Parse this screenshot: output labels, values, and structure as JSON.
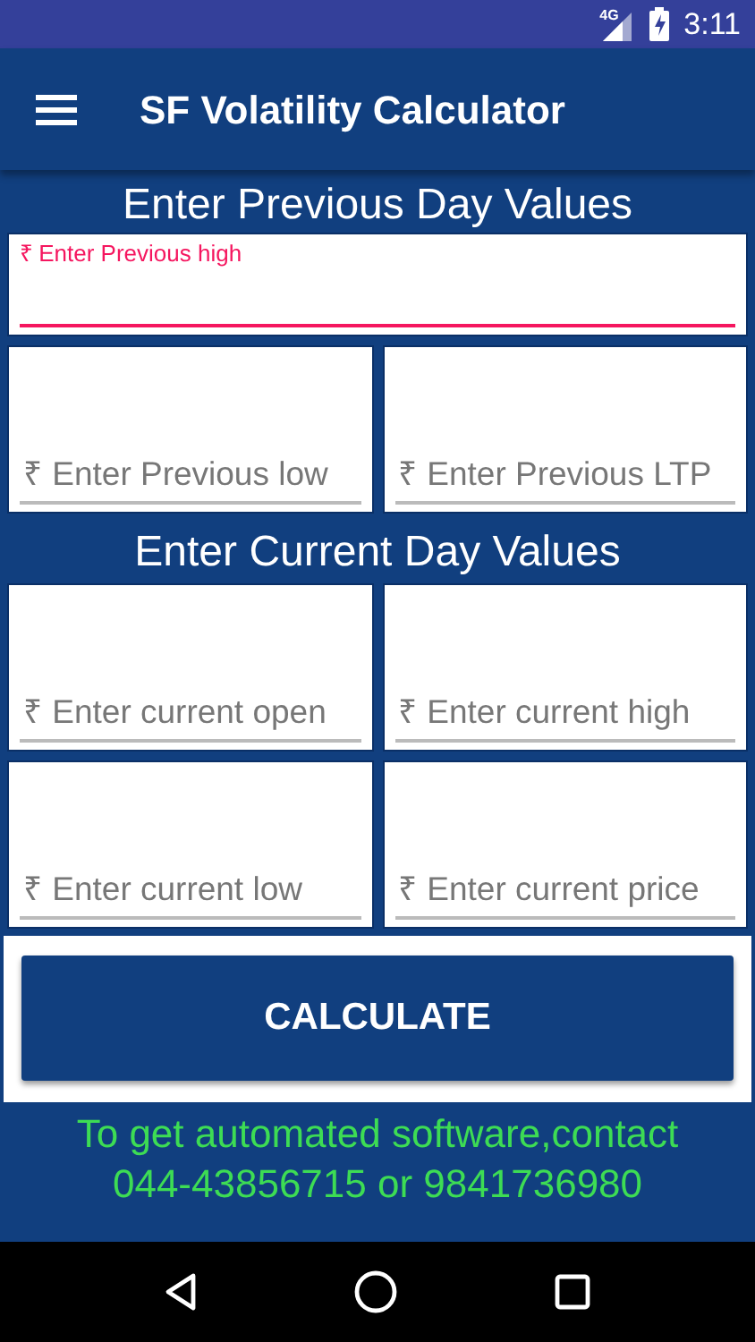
{
  "status_bar": {
    "time": "3:11",
    "network": "4G"
  },
  "app_bar": {
    "title": "SF Volatility Calculator"
  },
  "sections": [
    {
      "title": "Enter Previous Day Values",
      "fields": [
        {
          "placeholder": "₹ Enter Previous high",
          "focused": true,
          "wide": true
        },
        {
          "placeholder": "₹ Enter Previous low",
          "focused": false,
          "wide": false
        },
        {
          "placeholder": "₹ Enter Previous LTP",
          "focused": false,
          "wide": false
        }
      ]
    },
    {
      "title": "Enter Current Day Values",
      "fields": [
        {
          "placeholder": "₹ Enter current open",
          "focused": false,
          "wide": false
        },
        {
          "placeholder": "₹ Enter current high",
          "focused": false,
          "wide": false
        },
        {
          "placeholder": "₹ Enter current low",
          "focused": false,
          "wide": false
        },
        {
          "placeholder": "₹ Enter current price",
          "focused": false,
          "wide": false
        }
      ]
    }
  ],
  "button": {
    "label": "CALCULATE"
  },
  "footer": [
    "To get automated software,contact",
    "044-43856715 or 9841736980"
  ]
}
